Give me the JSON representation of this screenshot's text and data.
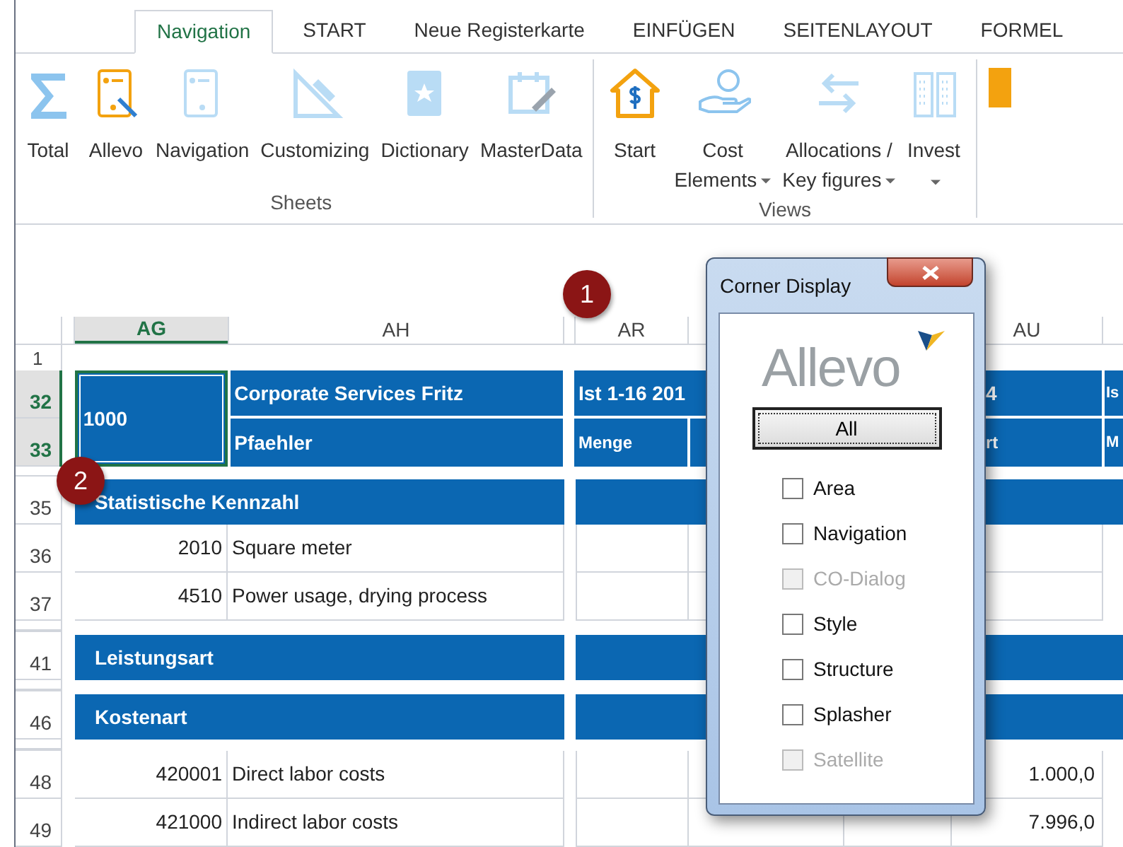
{
  "tabs": [
    {
      "label": "Navigation",
      "selected": true
    },
    {
      "label": "START",
      "selected": false
    },
    {
      "label": "Neue Registerkarte",
      "selected": false
    },
    {
      "label": "EINFÜGEN",
      "selected": false
    },
    {
      "label": "SEITENLAYOUT",
      "selected": false
    },
    {
      "label": "FORMEL",
      "selected": false
    }
  ],
  "ribbon": {
    "groups": [
      {
        "label": "Sheets",
        "buttons": [
          {
            "lines": [
              "Total"
            ],
            "dropdown": false
          },
          {
            "lines": [
              "Allevo"
            ],
            "dropdown": false
          },
          {
            "lines": [
              "Navigation"
            ],
            "dropdown": false
          },
          {
            "lines": [
              "Customizing"
            ],
            "dropdown": false
          },
          {
            "lines": [
              "Dictionary"
            ],
            "dropdown": false
          },
          {
            "lines": [
              "MasterData"
            ],
            "dropdown": false
          }
        ]
      },
      {
        "label": "Views",
        "buttons": [
          {
            "lines": [
              "Start"
            ],
            "dropdown": false
          },
          {
            "lines": [
              "Cost",
              "Elements"
            ],
            "dropdown": true
          },
          {
            "lines": [
              "Allocations /",
              "Key figures"
            ],
            "dropdown": true
          },
          {
            "lines": [
              "Invest"
            ],
            "dropdown": true
          }
        ]
      }
    ]
  },
  "sheet": {
    "columns": [
      {
        "label": "AG",
        "selected": true
      },
      {
        "label": "AH",
        "selected": false
      },
      {
        "label": "AR",
        "selected": false
      },
      {
        "label": "AU",
        "selected": false
      }
    ],
    "first_row": "1",
    "header": {
      "rows": [
        {
          "row": "32",
          "selected": true
        },
        {
          "row": "33",
          "selected": true
        }
      ],
      "code": "1000",
      "title": "Corporate Services Fritz",
      "subtitle": "Pfaehler",
      "period": "Ist 1-16 201",
      "period_tail": "4",
      "measure": "Menge",
      "value_tail": "rt",
      "next_period": "Is",
      "next_measure": "M"
    },
    "rows": [
      {
        "row": "35",
        "kind": "section",
        "label": "Statistische Kennzahl"
      },
      {
        "row": "36",
        "kind": "item",
        "code": "2010",
        "name": "Square meter"
      },
      {
        "row": "37",
        "kind": "item",
        "code": "4510",
        "name": "Power usage, drying process"
      },
      {
        "row": "41",
        "kind": "section",
        "label": "Leistungsart"
      },
      {
        "row": "46",
        "kind": "section",
        "label": "Kostenart"
      },
      {
        "row": "48",
        "kind": "item",
        "code": "420001",
        "name": "Direct labor costs",
        "value": "1.000,0"
      },
      {
        "row": "49",
        "kind": "item",
        "code": "421000",
        "name": "Indirect labor costs",
        "value": "7.996,0"
      }
    ]
  },
  "callouts": [
    {
      "label": "1"
    },
    {
      "label": "2"
    }
  ],
  "dialog": {
    "title": "Corner Display",
    "logo": "Allevo",
    "button": "All",
    "options": [
      {
        "label": "Area",
        "checked": false,
        "disabled": false
      },
      {
        "label": "Navigation",
        "checked": false,
        "disabled": false
      },
      {
        "label": "CO-Dialog",
        "checked": false,
        "disabled": true
      },
      {
        "label": "Style",
        "checked": false,
        "disabled": false
      },
      {
        "label": "Structure",
        "checked": false,
        "disabled": false
      },
      {
        "label": "Splasher",
        "checked": false,
        "disabled": false
      },
      {
        "label": "Satellite",
        "checked": false,
        "disabled": true
      }
    ]
  }
}
